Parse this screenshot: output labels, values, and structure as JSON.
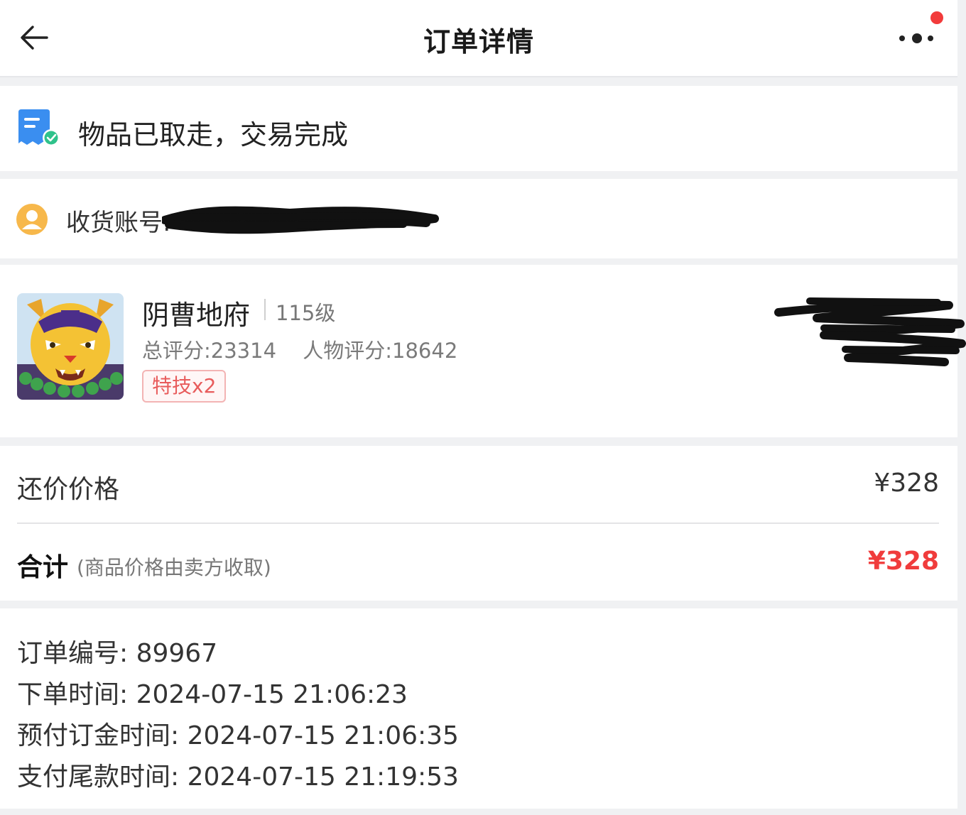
{
  "header": {
    "title": "订单详情",
    "back_icon": "arrow-left-icon",
    "more_icon": "more-dots-icon",
    "notification_dot_color": "#f23b3b"
  },
  "status": {
    "icon": "order-complete-icon",
    "text": "物品已取走，交易完成"
  },
  "account": {
    "icon": "user-avatar-icon",
    "label": "收货账号:"
  },
  "item": {
    "name": "阴曹地府",
    "level": "115级",
    "total_score": "总评分:23314",
    "char_score": "人物评分:18642",
    "tag": "特技x2"
  },
  "price": {
    "counter_label": "还价价格",
    "counter_value": "¥328",
    "total_label": "合计",
    "total_note": "(商品价格由卖方收取)",
    "total_value": "¥328",
    "accent_color": "#f03c3c"
  },
  "info": {
    "order_no_label": "订单编号:",
    "order_no": "89967",
    "order_time_label": "下单时间:",
    "order_time": "2024-07-15 21:06:23",
    "deposit_time_label": "预付订金时间:",
    "deposit_time": "2024-07-15 21:06:35",
    "final_time_label": "支付尾款时间:",
    "final_time": "2024-07-15 21:19:53"
  }
}
